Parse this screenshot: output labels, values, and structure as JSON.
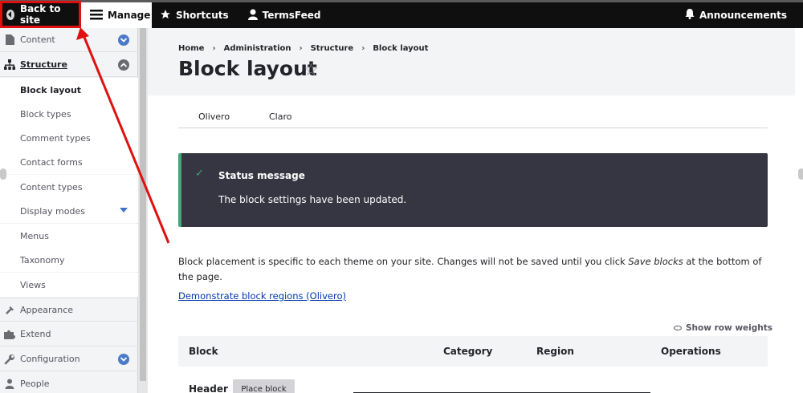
{
  "toolbar": {
    "back_to_site": "Back to site",
    "manage": "Manage",
    "shortcuts": "Shortcuts",
    "user": "TermsFeed",
    "announcements": "Announcements"
  },
  "sidebar": {
    "items": [
      {
        "label": "Content"
      },
      {
        "label": "Structure"
      },
      {
        "label": "Block layout"
      },
      {
        "label": "Block types"
      },
      {
        "label": "Comment types"
      },
      {
        "label": "Contact forms"
      },
      {
        "label": "Content types"
      },
      {
        "label": "Display modes"
      },
      {
        "label": "Menus"
      },
      {
        "label": "Taxonomy"
      },
      {
        "label": "Views"
      },
      {
        "label": "Appearance"
      },
      {
        "label": "Extend"
      },
      {
        "label": "Configuration"
      },
      {
        "label": "People"
      }
    ]
  },
  "breadcrumb": [
    "Home",
    "Administration",
    "Structure",
    "Block layout"
  ],
  "page": {
    "title": "Block layout",
    "tabs": [
      "Olivero",
      "Claro"
    ]
  },
  "status": {
    "title": "Status message",
    "message": "The block settings have been updated."
  },
  "description": {
    "before": "Block placement is specific to each theme on your site. Changes will not be saved until you click ",
    "emphasis": "Save blocks",
    "after": " at the bottom of the page."
  },
  "demo_link": "Demonstrate block regions (Olivero)",
  "row_weights": "Show row weights",
  "table": {
    "headers": [
      "Block",
      "Category",
      "Region",
      "Operations"
    ],
    "region_label": "Header",
    "place_block": "Place block"
  },
  "colors": {
    "toolbar_bg": "#0f0f0f",
    "highlight": "#e01010",
    "status_bg": "#353641",
    "status_accent": "#42a877",
    "link": "#0036b1",
    "toggle_blue": "#4c7ac8"
  }
}
